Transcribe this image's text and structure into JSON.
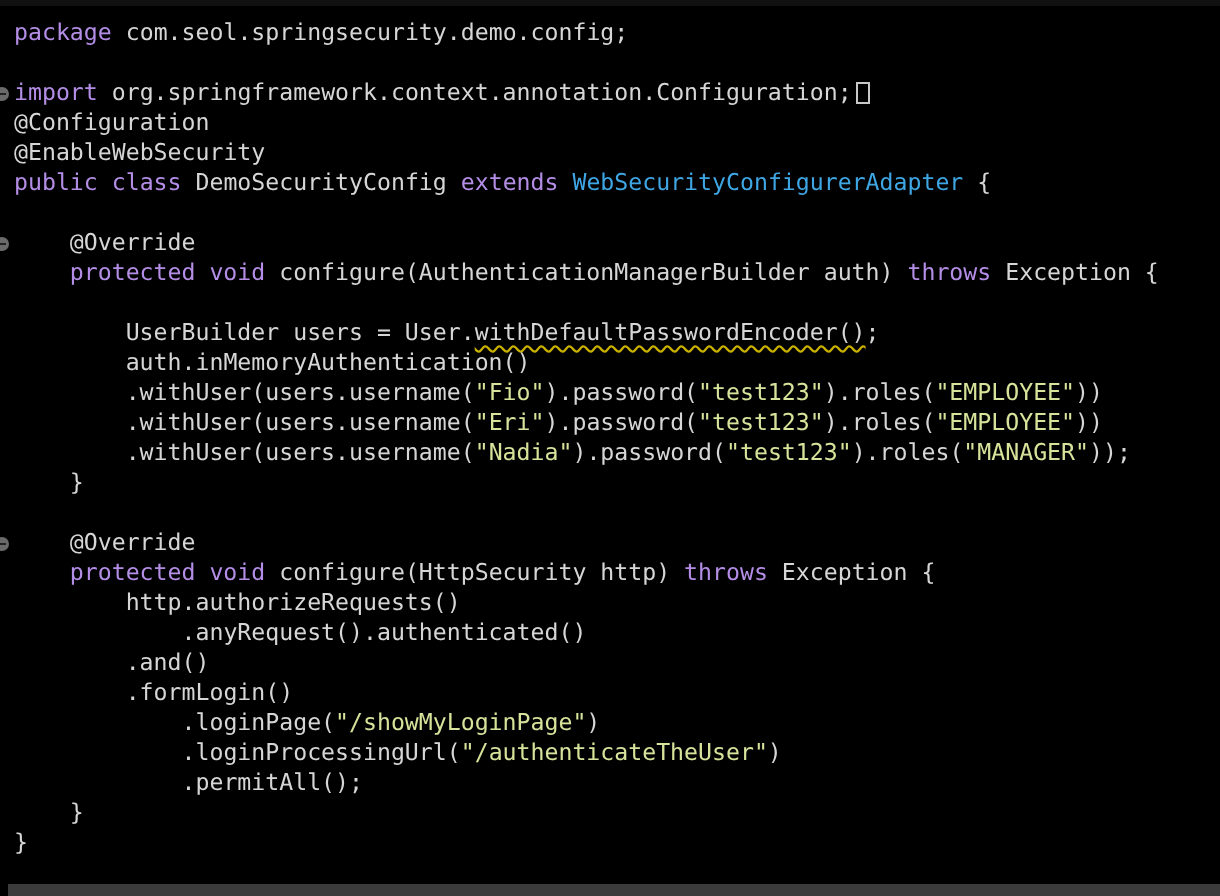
{
  "editor": {
    "lines": [
      {
        "kind": "plain",
        "tokens": [
          {
            "kind": "keyword",
            "text": "package"
          },
          {
            "kind": "plain",
            "text": " com.seol.springsecurity.demo.config;"
          }
        ]
      },
      {
        "kind": "plain"
      },
      {
        "kind": "collapsed",
        "tokens": [
          {
            "kind": "keyword",
            "text": "import"
          },
          {
            "kind": "plain",
            "text": " org.springframework.context.annotation.Configuration;"
          }
        ]
      },
      {
        "kind": "plain",
        "tokens": [
          {
            "kind": "plain",
            "text": "@Configuration"
          }
        ]
      },
      {
        "kind": "plain",
        "tokens": [
          {
            "kind": "plain",
            "text": "@EnableWebSecurity"
          }
        ]
      },
      {
        "kind": "plain",
        "tokens": [
          {
            "kind": "keyword",
            "text": "public class"
          },
          {
            "kind": "plain",
            "text": " DemoSecurityConfig "
          },
          {
            "kind": "keyword",
            "text": "extends "
          },
          {
            "kind": "type",
            "text": "WebSecurityConfigurerAdapter"
          },
          {
            "kind": "plain",
            "text": " {"
          }
        ]
      },
      {
        "kind": "plain"
      },
      {
        "kind": "fold",
        "tokens": [
          {
            "kind": "plain",
            "text": "    @Override"
          }
        ]
      },
      {
        "kind": "plain",
        "tokens": [
          {
            "kind": "keyword",
            "text": "    protected void"
          },
          {
            "kind": "plain",
            "text": " configure(AuthenticationManagerBuilder auth) "
          },
          {
            "kind": "keyword",
            "text": "throws"
          },
          {
            "kind": "plain",
            "text": " Exception {"
          }
        ]
      },
      {
        "kind": "plain"
      },
      {
        "kind": "plain",
        "tokens": [
          {
            "kind": "plain",
            "text": "        UserBuilder users = User."
          },
          {
            "kind": "warning",
            "text": "withDefaultPasswordEncoder()"
          },
          {
            "kind": "plain",
            "text": ";"
          }
        ]
      },
      {
        "kind": "plain",
        "tokens": [
          {
            "kind": "plain",
            "text": "        auth.inMemoryAuthentication()"
          }
        ]
      },
      {
        "kind": "plain",
        "tokens": [
          {
            "kind": "plain",
            "text": "        .withUser(users.username("
          },
          {
            "kind": "string",
            "text": "\"Fio\""
          },
          {
            "kind": "plain",
            "text": ").password("
          },
          {
            "kind": "string",
            "text": "\"test123\""
          },
          {
            "kind": "plain",
            "text": ").roles("
          },
          {
            "kind": "string",
            "text": "\"EMPLOYEE\""
          },
          {
            "kind": "plain",
            "text": "))"
          }
        ]
      },
      {
        "kind": "plain",
        "tokens": [
          {
            "kind": "plain",
            "text": "        .withUser(users.username("
          },
          {
            "kind": "string",
            "text": "\"Eri\""
          },
          {
            "kind": "plain",
            "text": ").password("
          },
          {
            "kind": "string",
            "text": "\"test123\""
          },
          {
            "kind": "plain",
            "text": ").roles("
          },
          {
            "kind": "string",
            "text": "\"EMPLOYEE\""
          },
          {
            "kind": "plain",
            "text": "))"
          }
        ]
      },
      {
        "kind": "plain",
        "tokens": [
          {
            "kind": "plain",
            "text": "        .withUser(users.username("
          },
          {
            "kind": "string",
            "text": "\"Nadia\""
          },
          {
            "kind": "plain",
            "text": ").password("
          },
          {
            "kind": "string",
            "text": "\"test123\""
          },
          {
            "kind": "plain",
            "text": ").roles("
          },
          {
            "kind": "string",
            "text": "\"MANAGER\""
          },
          {
            "kind": "plain",
            "text": "));"
          }
        ]
      },
      {
        "kind": "plain",
        "tokens": [
          {
            "kind": "plain",
            "text": "    }"
          }
        ]
      },
      {
        "kind": "plain"
      },
      {
        "kind": "fold",
        "tokens": [
          {
            "kind": "plain",
            "text": "    @Override"
          }
        ]
      },
      {
        "kind": "plain",
        "tokens": [
          {
            "kind": "keyword",
            "text": "    protected void"
          },
          {
            "kind": "plain",
            "text": " configure(HttpSecurity http) "
          },
          {
            "kind": "keyword",
            "text": "throws"
          },
          {
            "kind": "plain",
            "text": " Exception {"
          }
        ]
      },
      {
        "kind": "plain",
        "tokens": [
          {
            "kind": "plain",
            "text": "        http.authorizeRequests()"
          }
        ]
      },
      {
        "kind": "plain",
        "tokens": [
          {
            "kind": "plain",
            "text": "            .anyRequest().authenticated()"
          }
        ]
      },
      {
        "kind": "plain",
        "tokens": [
          {
            "kind": "plain",
            "text": "        .and()"
          }
        ]
      },
      {
        "kind": "plain",
        "tokens": [
          {
            "kind": "plain",
            "text": "        .formLogin()"
          }
        ]
      },
      {
        "kind": "plain",
        "tokens": [
          {
            "kind": "plain",
            "text": "            .loginPage("
          },
          {
            "kind": "string",
            "text": "\"/showMyLoginPage\""
          },
          {
            "kind": "plain",
            "text": ")"
          }
        ]
      },
      {
        "kind": "plain",
        "tokens": [
          {
            "kind": "plain",
            "text": "            .loginProcessingUrl("
          },
          {
            "kind": "string",
            "text": "\"/authenticateTheUser\""
          },
          {
            "kind": "plain",
            "text": ")"
          }
        ]
      },
      {
        "kind": "plain",
        "tokens": [
          {
            "kind": "plain",
            "text": "            .permitAll();"
          }
        ]
      },
      {
        "kind": "plain",
        "tokens": [
          {
            "kind": "plain",
            "text": "    }"
          }
        ]
      },
      {
        "kind": "plain",
        "tokens": [
          {
            "kind": "plain",
            "text": "}"
          }
        ]
      }
    ]
  }
}
